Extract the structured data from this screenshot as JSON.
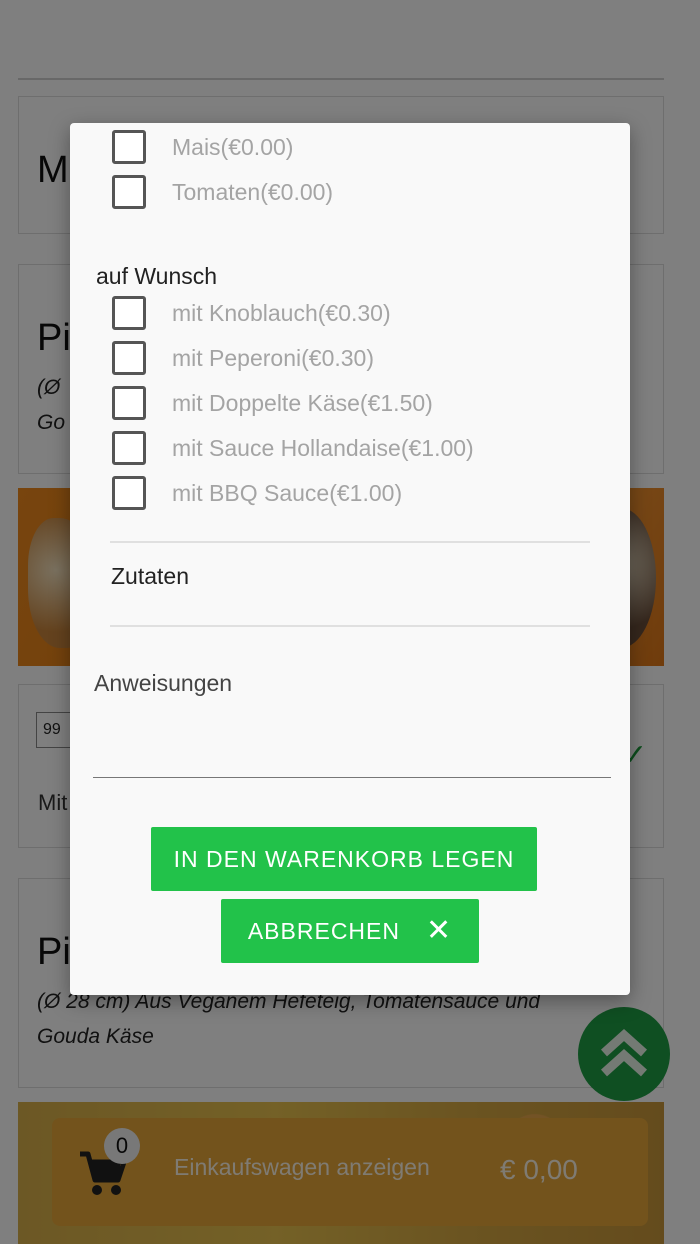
{
  "background": {
    "cards": [
      {
        "title": "M"
      },
      {
        "title": "Pi",
        "desc_line1": "(Ø",
        "desc_line2": "Go"
      },
      {
        "title": "Pi",
        "desc_line1": "(Ø 28 cm) Aus Veganem Hefeteig, Tomatensauce und",
        "desc_line2": "Gouda Käse"
      }
    ],
    "quantity_value": "99",
    "mit_text": "Mit",
    "green_mark": "✓"
  },
  "cart": {
    "count": "0",
    "label": "Einkaufswagen anzeigen",
    "total": "€ 0,00"
  },
  "modal": {
    "options_top": [
      {
        "label": "Mais(€0.00)"
      },
      {
        "label": "Tomaten(€0.00)"
      }
    ],
    "group_title": "auf Wunsch",
    "options_wunsch": [
      {
        "label": "mit Knoblauch(€0.30)"
      },
      {
        "label": "mit Peperoni(€0.30)"
      },
      {
        "label": "mit Doppelte Käse(€1.50)"
      },
      {
        "label": "mit Sauce Hollandaise(€1.00)"
      },
      {
        "label": "mit BBQ Sauce(€1.00)"
      }
    ],
    "zutaten_label": "Zutaten",
    "instructions_label": "Anweisungen",
    "instructions_value": "",
    "add_button": "IN DEN WARENKORB LEGEN",
    "cancel_button": "ABBRECHEN",
    "cancel_icon": "✕"
  },
  "colors": {
    "accent_green": "#22c24a",
    "scroll_green": "#1f9e44",
    "cart_orange": "#e7a638"
  }
}
